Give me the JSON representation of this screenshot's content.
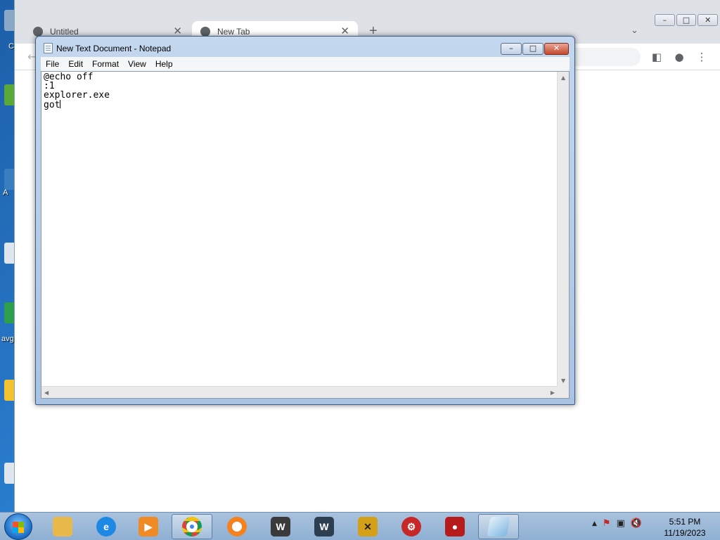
{
  "chrome": {
    "tabs": [
      {
        "title": "Untitled",
        "active": false
      },
      {
        "title": "New Tab",
        "active": true
      }
    ],
    "tab_close": "✕",
    "new_tab": "+",
    "tab_menu": "⌄",
    "window_buttons": {
      "minimize": "–",
      "maximize": "□",
      "close": "✕"
    }
  },
  "notepad": {
    "title": "New Text Document - Notepad",
    "menu": [
      "File",
      "Edit",
      "Format",
      "View",
      "Help"
    ],
    "lines": [
      "@echo off",
      ":1",
      "explorer.exe",
      "got"
    ],
    "buttons": {
      "minimize": "–",
      "maximize": "□",
      "close": "✕"
    }
  },
  "taskbar": {
    "apps": [
      {
        "name": "file-explorer",
        "label": "",
        "color": "#e8b84a"
      },
      {
        "name": "internet-explorer",
        "label": "e",
        "color": "#1e88e5"
      },
      {
        "name": "media-player",
        "label": "▶",
        "color": "#f08a24"
      },
      {
        "name": "chrome",
        "label": "",
        "color": "#db4437",
        "running": true
      },
      {
        "name": "avast-browser",
        "label": "",
        "color": "#f58220"
      },
      {
        "name": "world-of-tanks",
        "label": "W",
        "color": "#3a3a3a"
      },
      {
        "name": "world-of-warships",
        "label": "W",
        "color": "#2c3e50"
      },
      {
        "name": "game-x",
        "label": "✕",
        "color": "#d4a017"
      },
      {
        "name": "red-gear-app",
        "label": "⚙",
        "color": "#c62828"
      },
      {
        "name": "screen-recorder",
        "label": "●",
        "color": "#b71c1c"
      },
      {
        "name": "notepad",
        "label": "",
        "color": "#7eb6e0",
        "running": true
      }
    ],
    "tray": {
      "show_hidden": "▲",
      "network": "⚑",
      "flag": "▣",
      "volume": "🔇"
    },
    "time": "5:51 PM",
    "date": "11/19/2023"
  },
  "desktop": {
    "icon_labels": [
      "C",
      "A",
      "avg"
    ]
  }
}
